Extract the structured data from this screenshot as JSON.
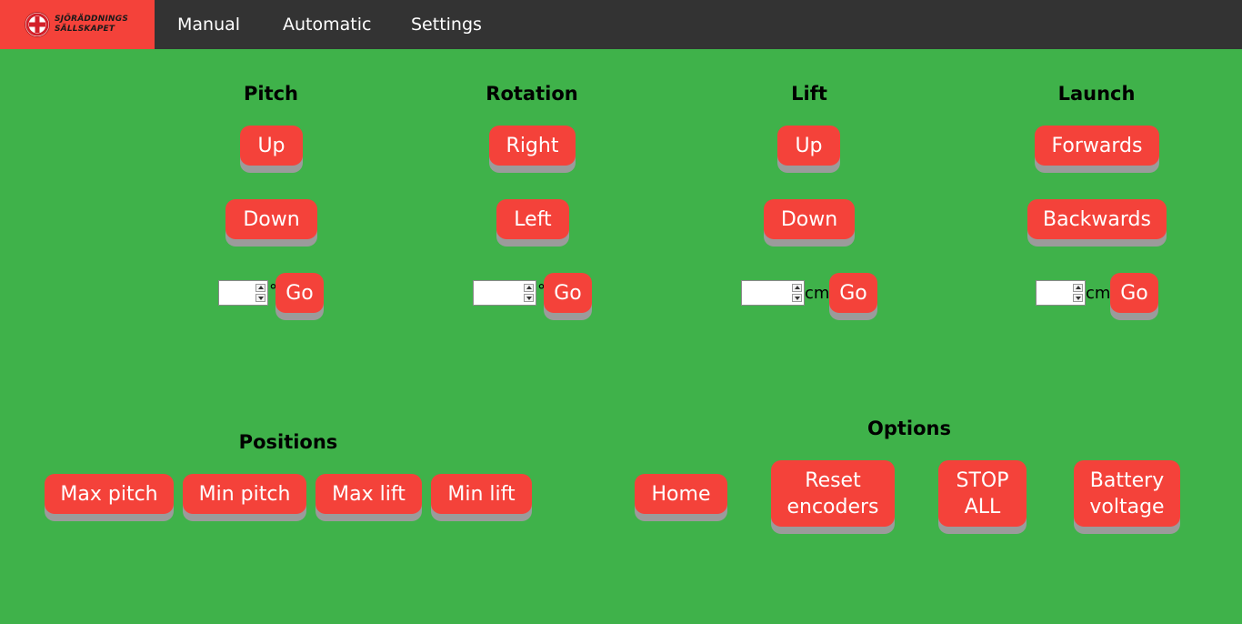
{
  "brand": {
    "line1": "SJÖRÄDDNINGS",
    "line2": "SÄLLSKAPET"
  },
  "nav": [
    "Manual",
    "Automatic",
    "Settings"
  ],
  "controls": {
    "pitch": {
      "title": "Pitch",
      "btn1": "Up",
      "btn2": "Down",
      "unit": "°",
      "go": "Go"
    },
    "rotation": {
      "title": "Rotation",
      "btn1": "Right",
      "btn2": "Left",
      "unit": "°",
      "go": "Go"
    },
    "lift": {
      "title": "Lift",
      "btn1": "Up",
      "btn2": "Down",
      "unit": "cm",
      "go": "Go"
    },
    "launch": {
      "title": "Launch",
      "btn1": "Forwards",
      "btn2": "Backwards",
      "unit": "cm",
      "go": "Go"
    }
  },
  "positions": {
    "title": "Positions",
    "buttons": [
      "Max pitch",
      "Min pitch",
      "Max lift",
      "Min lift"
    ]
  },
  "options": {
    "title": "Options",
    "home": "Home",
    "reset": [
      "Reset",
      "encoders"
    ],
    "stop": [
      "STOP",
      "ALL"
    ],
    "battery": [
      "Battery",
      "voltage"
    ]
  },
  "colors": {
    "background": "#3fb24a",
    "accent": "#f4423a",
    "topbar": "#333333"
  }
}
